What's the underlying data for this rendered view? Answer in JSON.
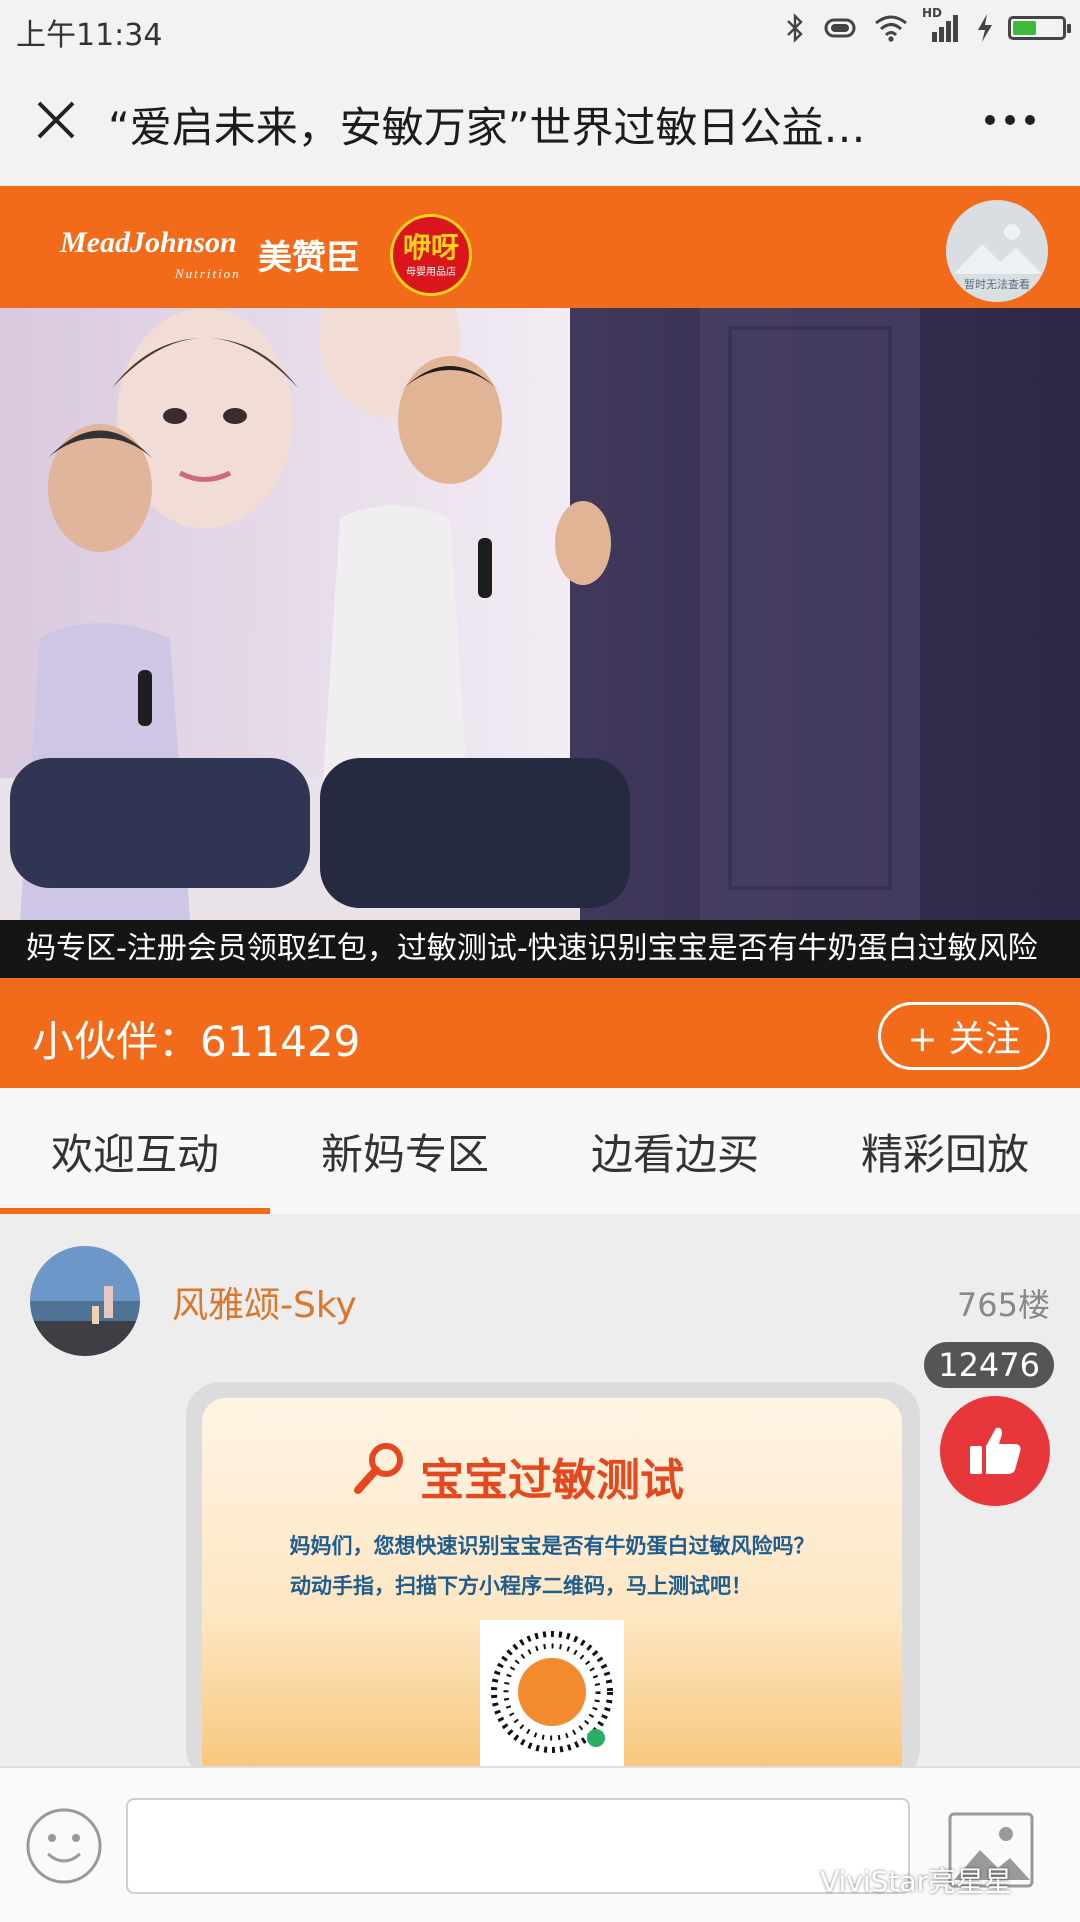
{
  "status_bar": {
    "time": "上午11:34",
    "network_label": "HD"
  },
  "title_bar": {
    "title": "“爱启未来，安敏万家”世界过敏日公益…"
  },
  "brand": {
    "mj_logo": "MeadJohnson",
    "mj_sub": "Nutrition",
    "mj_cn": "美赞臣",
    "yaya_main": "咿呀",
    "yaya_sub": "母婴用品店",
    "avatar_placeholder_text": "暂时无法查看"
  },
  "video": {
    "caption": "妈专区-注册会员领取红包，过敏测试-快速识别宝宝是否有牛奶蛋白过敏风险"
  },
  "partners": {
    "label": "小伙伴：611429",
    "follow_label": "+ 关注"
  },
  "tabs": [
    {
      "label": "欢迎互动",
      "active": true
    },
    {
      "label": "新妈专区",
      "active": false
    },
    {
      "label": "边看边买",
      "active": false
    },
    {
      "label": "精彩回放",
      "active": false
    }
  ],
  "comment": {
    "username": "风雅颂-Sky",
    "floor": "765楼",
    "like_count": "12476",
    "card": {
      "title": "宝宝过敏测试",
      "line1": "妈妈们，您想快速识别宝宝是否有牛奶蛋白过敏风险吗？",
      "line2": "动动手指，扫描下方小程序二维码，马上测试吧！"
    }
  },
  "bottom_bar": {
    "input_placeholder": "",
    "watermark": "ViviStar亮星星"
  },
  "colors": {
    "accent": "#f26b1b",
    "like": "#e8373b",
    "username": "#d9772c"
  },
  "icons": [
    "close-icon",
    "more-icon",
    "bluetooth-icon",
    "wifi-icon",
    "signal-icon",
    "charging-icon",
    "battery-icon",
    "thumbs-up-icon",
    "emoji-icon",
    "image-icon",
    "search-icon"
  ]
}
